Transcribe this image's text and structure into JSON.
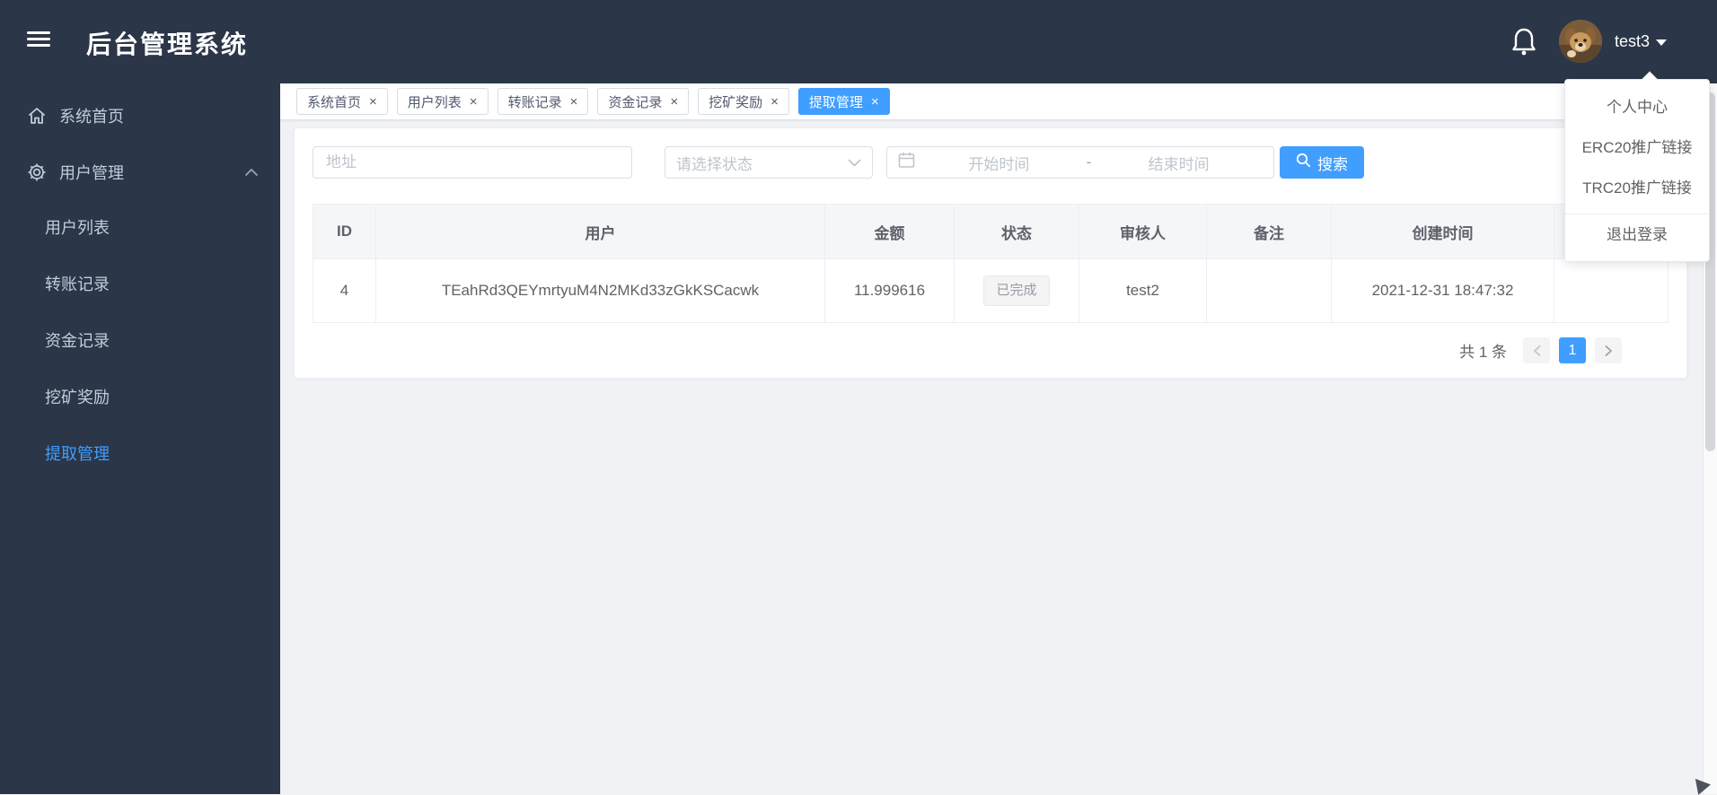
{
  "colors": {
    "accent": "#409eff",
    "sidebar_bg": "#2b3648",
    "content_bg": "#f0f2f5",
    "table_border": "#ebeef5",
    "tag_bg": "#f4f4f5",
    "tag_text": "#909399"
  },
  "header": {
    "title": "后台管理系统",
    "username": "test3"
  },
  "user_menu": {
    "items": [
      {
        "label": "个人中心"
      },
      {
        "label": "ERC20推广链接"
      },
      {
        "label": "TRC20推广链接"
      },
      {
        "label": "退出登录"
      }
    ]
  },
  "sidebar": {
    "items": [
      {
        "label": "系统首页",
        "icon": "home-icon"
      },
      {
        "label": "用户管理",
        "icon": "gear-icon",
        "expanded": true,
        "children": [
          {
            "label": "用户列表"
          },
          {
            "label": "转账记录"
          },
          {
            "label": "资金记录"
          },
          {
            "label": "挖矿奖励"
          },
          {
            "label": "提取管理",
            "active": true
          }
        ]
      }
    ]
  },
  "tabs": {
    "items": [
      {
        "label": "系统首页"
      },
      {
        "label": "用户列表"
      },
      {
        "label": "转账记录"
      },
      {
        "label": "资金记录"
      },
      {
        "label": "挖矿奖励"
      },
      {
        "label": "提取管理",
        "active": true
      }
    ]
  },
  "filters": {
    "address_placeholder": "地址",
    "status_placeholder": "请选择状态",
    "date_start_placeholder": "开始时间",
    "date_separator": "-",
    "date_end_placeholder": "结束时间",
    "search_label": "搜索"
  },
  "table": {
    "columns": [
      "ID",
      "用户",
      "金额",
      "状态",
      "审核人",
      "备注",
      "创建时间",
      ""
    ],
    "rows": [
      [
        "4",
        "TEahRd3QEYmrtyuM4N2MKd33zGkKSCacwk",
        "11.999616",
        "已完成",
        "test2",
        "",
        "2021-12-31 18:47:32",
        ""
      ]
    ]
  },
  "pagination": {
    "total": "共 1 条",
    "page": "1"
  },
  "icons": {
    "close": "×"
  }
}
